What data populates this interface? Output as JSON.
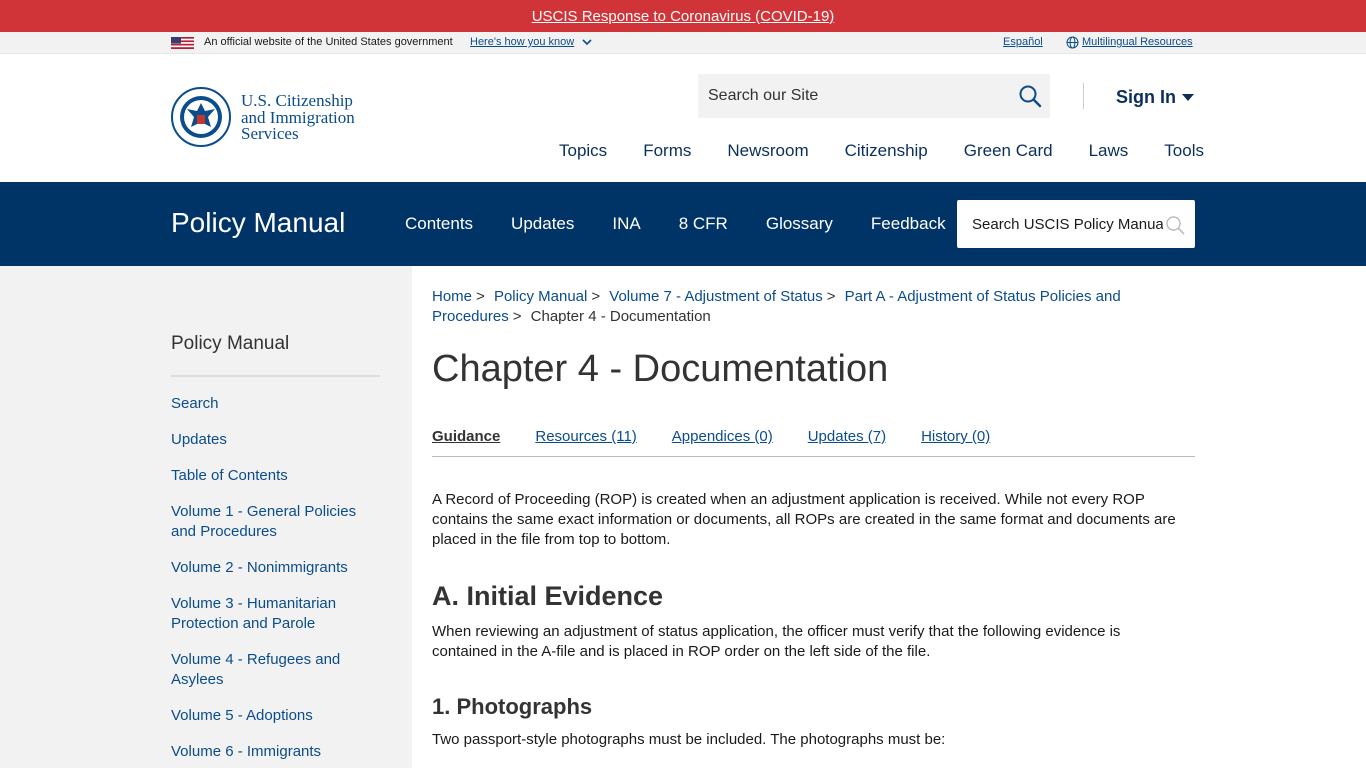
{
  "alert": {
    "text": "USCIS Response to Coronavirus (COVID-19)"
  },
  "gov_banner": {
    "official": "An official website of the United States government",
    "how": "Here's how you know",
    "espanol": "Español",
    "multilingual": "Multilingual Resources"
  },
  "header": {
    "logo_line1": "U.S. Citizenship",
    "logo_line2": "and Immigration",
    "logo_line3": "Services",
    "search_placeholder": "Search our Site",
    "signin": "Sign In",
    "nav": [
      "Topics",
      "Forms",
      "Newsroom",
      "Citizenship",
      "Green Card",
      "Laws",
      "Tools"
    ]
  },
  "policy_bar": {
    "title": "Policy Manual",
    "nav": [
      "Contents",
      "Updates",
      "INA",
      "8 CFR",
      "Glossary",
      "Feedback"
    ],
    "search_placeholder": "Search USCIS Policy Manual"
  },
  "sidebar": {
    "title": "Policy Manual",
    "items": [
      "Search",
      "Updates",
      "Table of Contents",
      "Volume 1 - General Policies and Procedures",
      "Volume 2 - Nonimmigrants",
      "Volume 3 - Humanitarian Protection and Parole",
      "Volume 4 - Refugees and Asylees",
      "Volume 5 - Adoptions",
      "Volume 6 - Immigrants"
    ]
  },
  "breadcrumb": {
    "items": [
      "Home",
      "Policy Manual",
      "Volume 7 - Adjustment of Status",
      "Part A - Adjustment of Status Policies and Procedures"
    ],
    "current": "Chapter 4 - Documentation"
  },
  "main": {
    "title": "Chapter 4 - Documentation",
    "tabs": [
      "Guidance",
      "Resources (11)",
      "Appendices (0)",
      "Updates (7)",
      "History (0)"
    ],
    "intro": "A Record of Proceeding (ROP) is created when an adjustment application is received. While not every ROP contains the same exact information or documents, all ROPs are created in the same format and documents are placed in the file from top to bottom.",
    "section_a_title": "A. Initial Evidence",
    "section_a_text": "When reviewing an adjustment of status application, the officer must verify that the following evidence is contained in the A-file and is placed in ROP order on the left side of the file.",
    "section_1_title": "1. Photographs",
    "section_1_text": "Two passport-style photographs must be included. The photographs must be:"
  },
  "colors": {
    "alert_red": "#d13438",
    "navy": "#003366",
    "link_blue": "#0b4c8c",
    "sidebar_gray": "#f2f2f2"
  },
  "icons": [
    "us-flag-icon",
    "chevron-down-icon",
    "globe-icon",
    "dhs-seal-icon",
    "search-icon",
    "caret-down-icon"
  ]
}
